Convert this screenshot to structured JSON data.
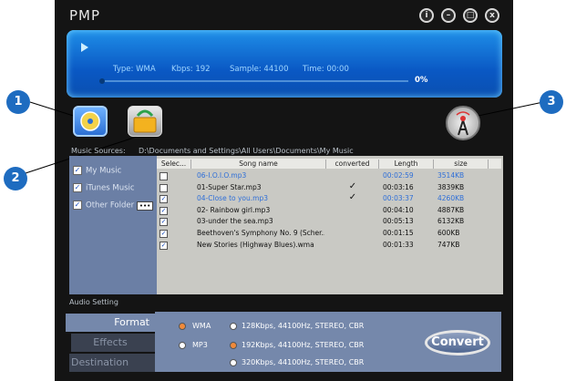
{
  "app": {
    "title": "PMP"
  },
  "window_buttons": [
    {
      "name": "info-button",
      "glyph": "i"
    },
    {
      "name": "minimize-button",
      "glyph": "–"
    },
    {
      "name": "maximize-button",
      "glyph": "□"
    },
    {
      "name": "close-button",
      "glyph": "x"
    }
  ],
  "display": {
    "type_label": "Type: WMA",
    "kbps_label": "Kbps: 192",
    "sample_label": "Sample: 44100",
    "time_label": "Time: 00:00",
    "percent": "0%",
    "progress_fraction": 0.0
  },
  "callouts": [
    "1",
    "2",
    "3"
  ],
  "toolbar": {
    "add_from_cd_icon": "cd-icon",
    "open_folder_icon": "folder-icon",
    "broadcast_icon": "antenna-icon"
  },
  "sources": {
    "label": "Music Sources:",
    "path": "D:\\Documents and Settings\\All Users\\Documents\\My Music",
    "items": [
      {
        "label": "My Music",
        "checked": true
      },
      {
        "label": "iTunes Music",
        "checked": true
      },
      {
        "label": "Other Folder",
        "checked": true
      }
    ],
    "more_button": "•••"
  },
  "table": {
    "headers": [
      "Selec...",
      "Song name",
      "converted",
      "Length",
      "size"
    ],
    "rows": [
      {
        "checked": false,
        "name": "06-I.O.I.O.mp3",
        "converted": "",
        "length": "00:02:59",
        "size": "3514KB",
        "highlight": true
      },
      {
        "checked": false,
        "name": "01-Super Star.mp3",
        "converted": "✓",
        "length": "00:03:16",
        "size": "3839KB",
        "highlight": false
      },
      {
        "checked": true,
        "name": "04-Close to you.mp3",
        "converted": "✓",
        "length": "00:03:37",
        "size": "4260KB",
        "highlight": true
      },
      {
        "checked": true,
        "name": "02- Rainbow girl.mp3",
        "converted": "",
        "length": "00:04:10",
        "size": "4887KB",
        "highlight": false
      },
      {
        "checked": true,
        "name": "03-under the sea.mp3",
        "converted": "",
        "length": "00:05:13",
        "size": "6132KB",
        "highlight": false
      },
      {
        "checked": true,
        "name": "Beethoven's Symphony No. 9 (Scher...",
        "converted": "",
        "length": "00:01:15",
        "size": "600KB",
        "highlight": false
      },
      {
        "checked": true,
        "name": "New Stories (Highway Blues).wma",
        "converted": "",
        "length": "00:01:33",
        "size": "747KB",
        "highlight": false
      }
    ]
  },
  "audio": {
    "label": "Audio Setting",
    "tabs": [
      "Format",
      "Effects",
      "Destination"
    ],
    "formats": [
      {
        "label": "WMA",
        "selected": true
      },
      {
        "label": "MP3",
        "selected": false
      }
    ],
    "qualities": [
      {
        "label": "128Kbps, 44100Hz, STEREO, CBR",
        "selected": false
      },
      {
        "label": "192Kbps, 44100Hz, STEREO, CBR",
        "selected": true
      },
      {
        "label": "320Kbps, 44100Hz, STEREO, CBR",
        "selected": false
      }
    ],
    "convert_label": "Convert"
  },
  "colors": {
    "accent": "#1e6cc0",
    "highlight_text": "#2f6fd8",
    "panel": "#6b7fa5"
  }
}
